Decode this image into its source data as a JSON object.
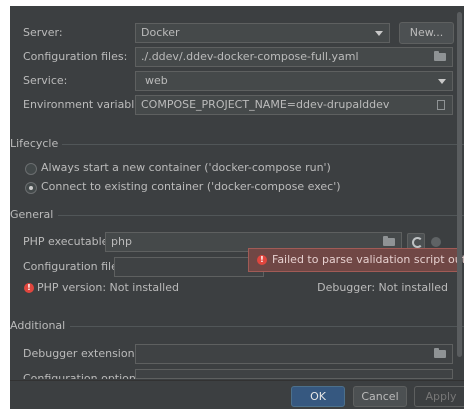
{
  "deployment": {
    "server_label": "Server:",
    "server_value": "Docker",
    "new_button": "New...",
    "config_files_label": "Configuration files:",
    "config_files_value": "./.ddev/.ddev-docker-compose-full.yaml",
    "service_label": "Service:",
    "service_value": "web",
    "env_vars_label": "Environment variables:",
    "env_vars_value": "COMPOSE_PROJECT_NAME=ddev-drupalddev"
  },
  "lifecycle": {
    "title": "Lifecycle",
    "option_new": "Always start a new container ('docker-compose run')",
    "option_existing": "Connect to existing container ('docker-compose exec')",
    "selected": "option_existing"
  },
  "general": {
    "title": "General",
    "php_exec_label": "PHP executable:",
    "php_exec_value": "php",
    "config_file_label": "Configuration file:",
    "config_file_value": "",
    "php_version_text": "PHP version: Not installed",
    "debugger_text": "Debugger: Not installed",
    "error_tooltip": "Failed to parse validation script output"
  },
  "additional": {
    "title": "Additional",
    "debugger_ext_label": "Debugger extension:",
    "debugger_ext_value": "",
    "config_options_label": "Configuration options:",
    "config_options_value": ""
  },
  "footer": {
    "ok": "OK",
    "cancel": "Cancel",
    "apply": "Apply"
  },
  "colors": {
    "background": "#3c3f41",
    "field": "#45494a",
    "primary_button": "#365880",
    "error": "#e0463e",
    "tooltip": "#704745"
  }
}
